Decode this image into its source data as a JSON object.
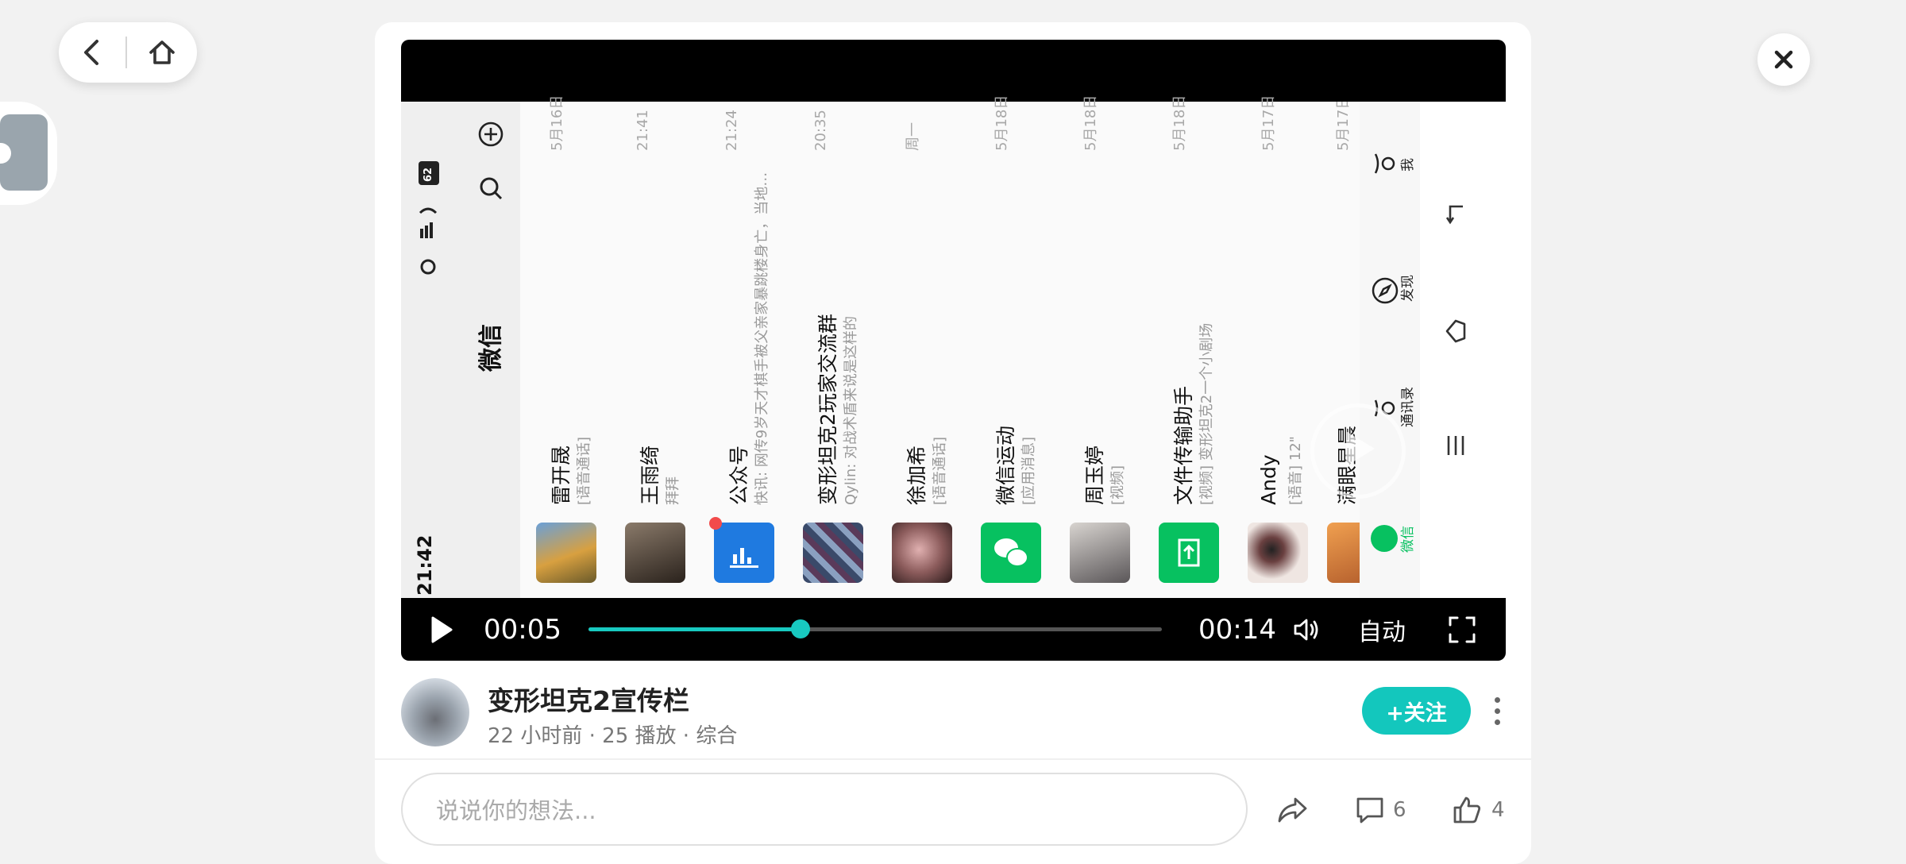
{
  "video": {
    "current_time": "00:05",
    "duration": "00:14",
    "progress": 0.37,
    "quality": "自动"
  },
  "phone": {
    "status_time": "21:42",
    "battery": "62",
    "title": "微信",
    "chats": [
      {
        "name": "雷开晟",
        "preview": "[语音通话]",
        "time": "5月16日",
        "avatar_color": "#b88a3a"
      },
      {
        "name": "王雨绮",
        "preview": "拜拜",
        "time": "21:41",
        "avatar_color": "#3b332c"
      },
      {
        "name": "公众号",
        "preview": "快讯: 网传9岁天才棋手被父亲家暴跳楼身亡，当地…",
        "time": "21:24",
        "avatar_color": "#1f7ae0",
        "unread": true
      },
      {
        "name": "变形坦克2玩家交流群",
        "preview": "Qylin: 对战术盾来说是这样的",
        "time": "20:35",
        "avatar_color": "#5b6e8c"
      },
      {
        "name": "徐加希",
        "preview": "[语音通话]",
        "time": "周一",
        "avatar_color": "#9a6a6a"
      },
      {
        "name": "微信运动",
        "preview": "[应用消息]",
        "time": "5月18日",
        "avatar_color": "#07c160"
      },
      {
        "name": "周玉婷",
        "preview": "[视频]",
        "time": "5月18日",
        "avatar_color": "#7d7b80"
      },
      {
        "name": "文件传输助手",
        "preview": "[视频] 变形坦克2一个小剧场",
        "time": "5月18日",
        "avatar_color": "#07c160"
      },
      {
        "name": "Andy",
        "preview": "[语音] 12\"",
        "time": "5月17日",
        "avatar_color": "#e8e0dc"
      },
      {
        "name": "满眼星晨",
        "preview": "",
        "time": "5月17日",
        "avatar_color": "#e08a4a"
      }
    ],
    "tabs": [
      "微信",
      "通讯录",
      "发现",
      "我"
    ]
  },
  "author": {
    "name": "变形坦克2宣传栏",
    "posted": "22 小时前",
    "plays": "25 播放",
    "category": "综合",
    "follow_label": "+关注"
  },
  "comment": {
    "placeholder": "说说你的想法...",
    "comment_count": "6",
    "like_count": "4"
  },
  "colors": {
    "accent": "#13c7bd",
    "wechat_green": "#07c160"
  }
}
